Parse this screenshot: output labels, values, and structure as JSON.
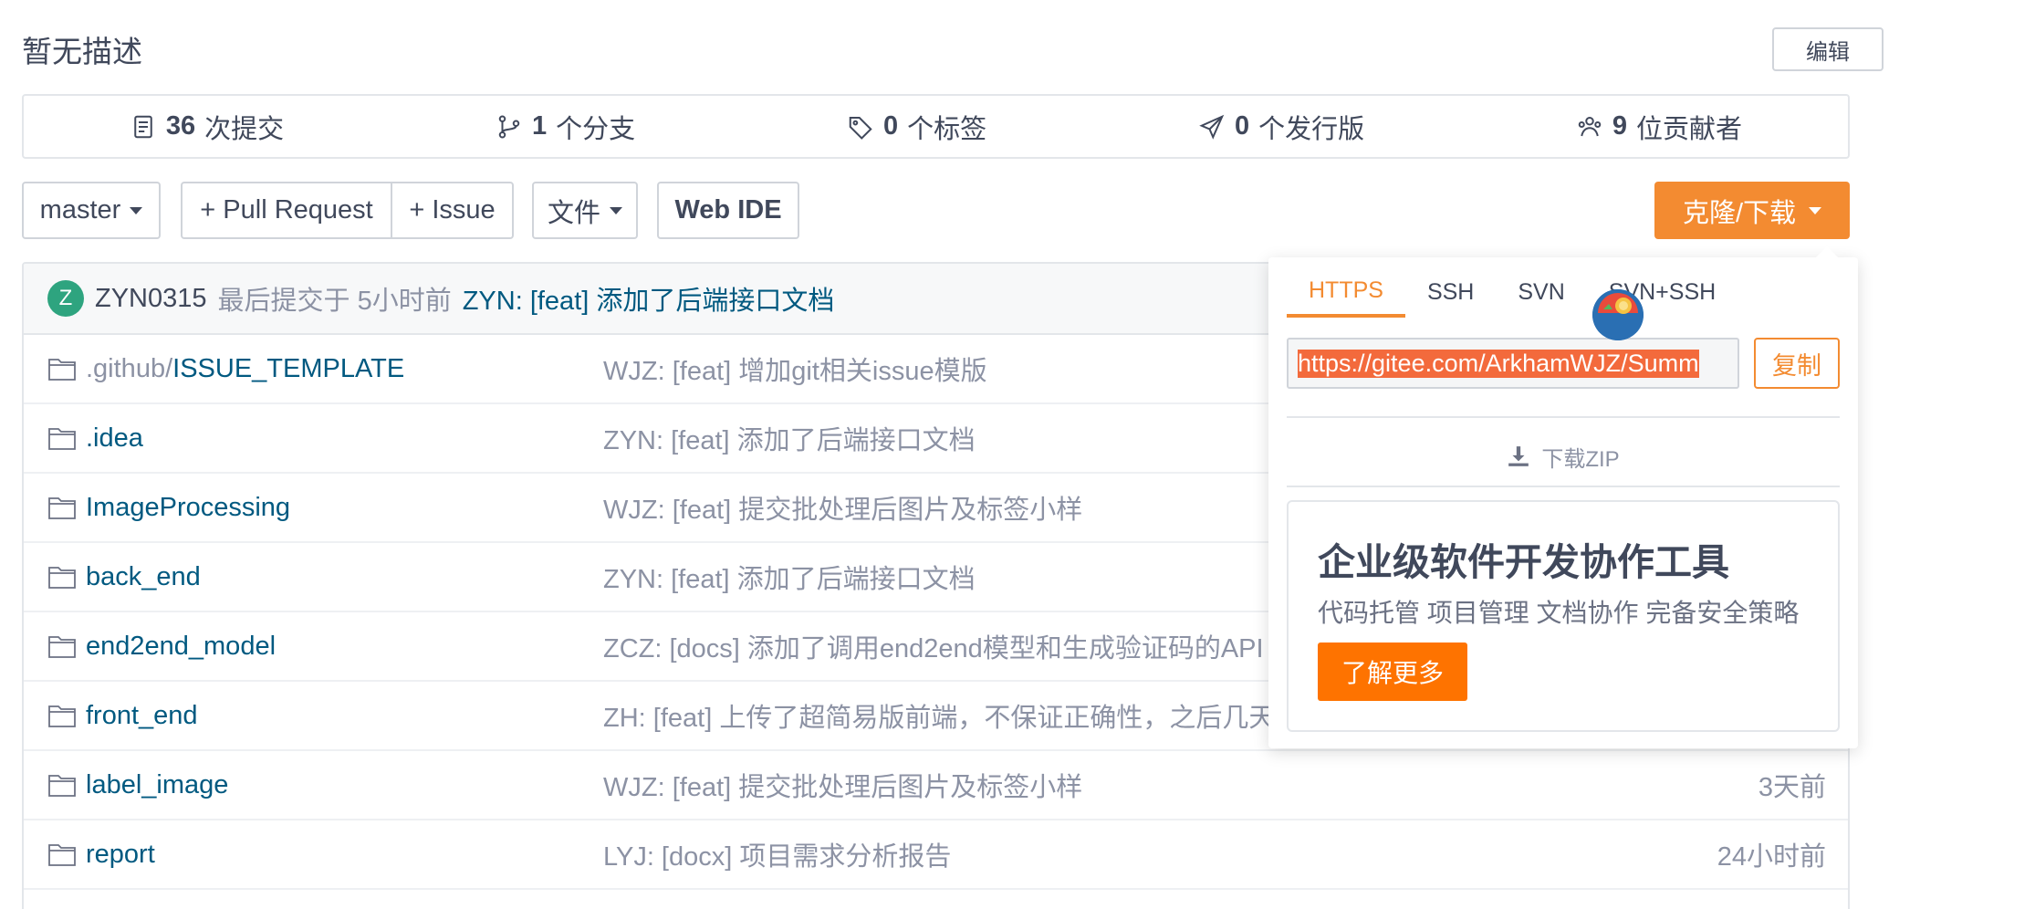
{
  "repo": {
    "description": "暂无描述",
    "edit_label": "编辑"
  },
  "stats": [
    {
      "count": "36",
      "label": "次提交",
      "icon": "commit-icon"
    },
    {
      "count": "1",
      "label": "个分支",
      "icon": "branch-icon"
    },
    {
      "count": "0",
      "label": "个标签",
      "icon": "tag-icon"
    },
    {
      "count": "0",
      "label": "个发行版",
      "icon": "release-icon"
    },
    {
      "count": "9",
      "label": "位贡献者",
      "icon": "contributors-icon"
    }
  ],
  "toolbar": {
    "branch": "master",
    "pull_request": "+ Pull Request",
    "issue": "+ Issue",
    "file": "文件",
    "web_ide": "Web IDE",
    "clone": "克隆/下载"
  },
  "last_commit": {
    "avatar_letter": "Z",
    "user": "ZYN0315",
    "meta": "最后提交于 5小时前",
    "message": "ZYN: [feat] 添加了后端接口文档"
  },
  "files": [
    {
      "prefix": ".github/",
      "name": "ISSUE_TEMPLATE",
      "message": "WJZ: [feat] 增加git相关issue模版",
      "time": ""
    },
    {
      "prefix": "",
      "name": ".idea",
      "message": "ZYN: [feat] 添加了后端接口文档",
      "time": ""
    },
    {
      "prefix": "",
      "name": "ImageProcessing",
      "message": "WJZ: [feat] 提交批处理后图片及标签小样",
      "time": ""
    },
    {
      "prefix": "",
      "name": "back_end",
      "message": "ZYN: [feat] 添加了后端接口文档",
      "time": ""
    },
    {
      "prefix": "",
      "name": "end2end_model",
      "message": "ZCZ: [docs] 添加了调用end2end模型和生成验证码的API",
      "time": ""
    },
    {
      "prefix": "",
      "name": "front_end",
      "message": "ZH: [feat] 上传了超简易版前端，不保证正确性，之后几天完",
      "time": ""
    },
    {
      "prefix": "",
      "name": "label_image",
      "message": "WJZ: [feat] 提交批处理后图片及标签小样",
      "time": "3天前"
    },
    {
      "prefix": "",
      "name": "report",
      "message": "LYJ: [docx] 项目需求分析报告",
      "time": "24小时前"
    }
  ],
  "clone_panel": {
    "tabs": [
      "HTTPS",
      "SSH",
      "SVN",
      "SVN+SSH"
    ],
    "active_tab": "HTTPS",
    "url": "https://gitee.com/ArkhamWJZ/Summ",
    "copy_label": "复制",
    "download_zip": "下载ZIP",
    "promo_title": "企业级软件开发协作工具",
    "promo_subtitle": "代码托管 项目管理 文档协作 完备安全策略",
    "promo_button": "了解更多"
  },
  "colors": {
    "accent": "#f38b31",
    "link": "#005980",
    "promo_button": "#fe7300",
    "avatar": "#2ea47f"
  }
}
